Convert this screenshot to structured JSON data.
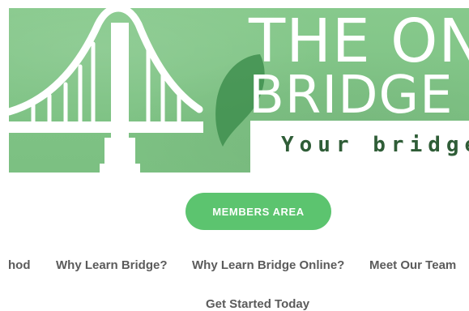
{
  "hero": {
    "title_line1": "THE ON",
    "title_line2": "BRIDGE S",
    "tagline": "Your bridge"
  },
  "members_button": {
    "label": "MEMBERS AREA"
  },
  "nav": {
    "row1": [
      {
        "label": "hod"
      },
      {
        "label": "Why Learn Bridge?"
      },
      {
        "label": "Why Learn Bridge Online?"
      },
      {
        "label": "Meet Our Team"
      }
    ],
    "row2": [
      {
        "label": "Get Started Today"
      }
    ]
  },
  "colors": {
    "banner_green": "#7fc385",
    "button_green": "#5cc46f",
    "nav_text": "#5b5b5b",
    "tagline_text": "#2f5d37"
  },
  "icons": {
    "bridge": "bridge-illustration",
    "leaf": "leaf-illustration"
  }
}
